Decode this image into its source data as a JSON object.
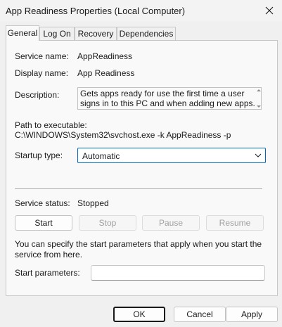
{
  "window": {
    "title": "App Readiness Properties (Local Computer)"
  },
  "tabs": [
    {
      "label": "General",
      "active": true
    },
    {
      "label": "Log On",
      "active": false
    },
    {
      "label": "Recovery",
      "active": false
    },
    {
      "label": "Dependencies",
      "active": false
    }
  ],
  "general": {
    "service_name_label": "Service name:",
    "service_name_value": "AppReadiness",
    "display_name_label": "Display name:",
    "display_name_value": "App Readiness",
    "description_label": "Description:",
    "description_value": "Gets apps ready for use the first time a user signs in to this PC and when adding new apps.",
    "path_label": "Path to executable:",
    "path_value": "C:\\WINDOWS\\System32\\svchost.exe -k AppReadiness -p",
    "startup_type_label": "Startup type:",
    "startup_type_value": "Automatic",
    "service_status_label": "Service status:",
    "service_status_value": "Stopped",
    "buttons": {
      "start": "Start",
      "stop": "Stop",
      "pause": "Pause",
      "resume": "Resume"
    },
    "info_text": "You can specify the start parameters that apply when you start the service from here.",
    "start_params_label": "Start parameters:",
    "start_params_value": ""
  },
  "footer": {
    "ok": "OK",
    "cancel": "Cancel",
    "apply": "Apply"
  },
  "icons": {
    "close": "close-icon",
    "chevron": "chevron-down-icon"
  },
  "colors": {
    "accent": "#0067c0",
    "disabled_text": "#a0a0a0"
  }
}
